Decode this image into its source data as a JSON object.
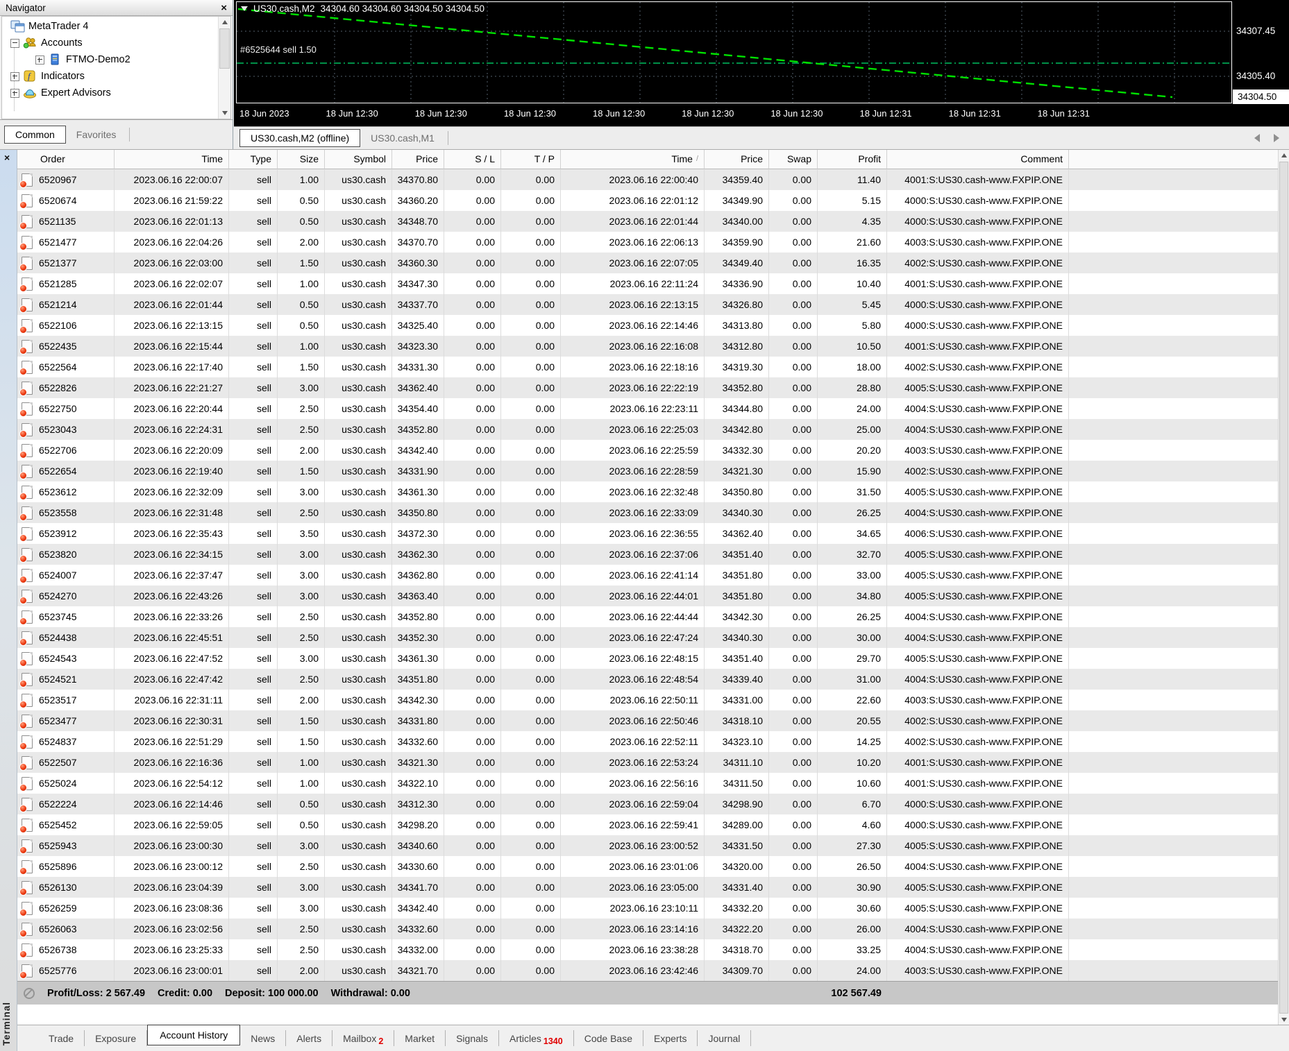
{
  "colors": {
    "chart_line": "#00e100",
    "chart_level": "#00c060",
    "grid": "#55616d",
    "badge": "#e00000"
  },
  "navigator": {
    "title": "Navigator",
    "tree": [
      {
        "label": "MetaTrader 4",
        "icon": "metatrader-icon",
        "level": 0,
        "expander": "none"
      },
      {
        "label": "Accounts",
        "icon": "accounts-icon",
        "level": 1,
        "expander": "minus"
      },
      {
        "label": "FTMO-Demo2",
        "icon": "account-server-icon",
        "level": 2,
        "expander": "plus"
      },
      {
        "label": "Indicators",
        "icon": "indicators-icon",
        "level": 1,
        "expander": "plus"
      },
      {
        "label": "Expert Advisors",
        "icon": "expert-advisors-icon",
        "level": 1,
        "expander": "plus"
      }
    ],
    "tabs": [
      {
        "label": "Common",
        "active": true
      },
      {
        "label": "Favorites",
        "active": false
      }
    ]
  },
  "chart": {
    "symbol_period": "US30.cash,M2",
    "ohlc": "34304.60 34304.60 34304.50 34304.50",
    "order_label": "#6525644 sell 1.50",
    "scale_labels": [
      "34307.45",
      "34305.40"
    ],
    "current_price": "34304.50",
    "time_axis": [
      "18 Jun 2023",
      "18 Jun 12:30",
      "18 Jun 12:30",
      "18 Jun 12:30",
      "18 Jun 12:30",
      "18 Jun 12:30",
      "18 Jun 12:30",
      "18 Jun 12:31",
      "18 Jun 12:31",
      "18 Jun 12:31"
    ]
  },
  "chart_tabs": [
    {
      "label": "US30.cash,M2 (offline)",
      "active": true
    },
    {
      "label": "US30.cash,M1",
      "active": false
    }
  ],
  "terminal": {
    "caption": "Terminal",
    "history": {
      "columns": [
        "Order",
        "Time",
        "Type",
        "Size",
        "Symbol",
        "Price",
        "S / L",
        "T / P",
        "Time",
        "Price",
        "Swap",
        "Profit",
        "Comment"
      ],
      "rows": [
        [
          "6520967",
          "2023.06.16 22:00:07",
          "sell",
          "1.00",
          "us30.cash",
          "34370.80",
          "0.00",
          "0.00",
          "2023.06.16 22:00:40",
          "34359.40",
          "0.00",
          "11.40",
          "4001:S:US30.cash-www.FXPIP.ONE"
        ],
        [
          "6520674",
          "2023.06.16 21:59:22",
          "sell",
          "0.50",
          "us30.cash",
          "34360.20",
          "0.00",
          "0.00",
          "2023.06.16 22:01:12",
          "34349.90",
          "0.00",
          "5.15",
          "4000:S:US30.cash-www.FXPIP.ONE"
        ],
        [
          "6521135",
          "2023.06.16 22:01:13",
          "sell",
          "0.50",
          "us30.cash",
          "34348.70",
          "0.00",
          "0.00",
          "2023.06.16 22:01:44",
          "34340.00",
          "0.00",
          "4.35",
          "4000:S:US30.cash-www.FXPIP.ONE"
        ],
        [
          "6521477",
          "2023.06.16 22:04:26",
          "sell",
          "2.00",
          "us30.cash",
          "34370.70",
          "0.00",
          "0.00",
          "2023.06.16 22:06:13",
          "34359.90",
          "0.00",
          "21.60",
          "4003:S:US30.cash-www.FXPIP.ONE"
        ],
        [
          "6521377",
          "2023.06.16 22:03:00",
          "sell",
          "1.50",
          "us30.cash",
          "34360.30",
          "0.00",
          "0.00",
          "2023.06.16 22:07:05",
          "34349.40",
          "0.00",
          "16.35",
          "4002:S:US30.cash-www.FXPIP.ONE"
        ],
        [
          "6521285",
          "2023.06.16 22:02:07",
          "sell",
          "1.00",
          "us30.cash",
          "34347.30",
          "0.00",
          "0.00",
          "2023.06.16 22:11:24",
          "34336.90",
          "0.00",
          "10.40",
          "4001:S:US30.cash-www.FXPIP.ONE"
        ],
        [
          "6521214",
          "2023.06.16 22:01:44",
          "sell",
          "0.50",
          "us30.cash",
          "34337.70",
          "0.00",
          "0.00",
          "2023.06.16 22:13:15",
          "34326.80",
          "0.00",
          "5.45",
          "4000:S:US30.cash-www.FXPIP.ONE"
        ],
        [
          "6522106",
          "2023.06.16 22:13:15",
          "sell",
          "0.50",
          "us30.cash",
          "34325.40",
          "0.00",
          "0.00",
          "2023.06.16 22:14:46",
          "34313.80",
          "0.00",
          "5.80",
          "4000:S:US30.cash-www.FXPIP.ONE"
        ],
        [
          "6522435",
          "2023.06.16 22:15:44",
          "sell",
          "1.00",
          "us30.cash",
          "34323.30",
          "0.00",
          "0.00",
          "2023.06.16 22:16:08",
          "34312.80",
          "0.00",
          "10.50",
          "4001:S:US30.cash-www.FXPIP.ONE"
        ],
        [
          "6522564",
          "2023.06.16 22:17:40",
          "sell",
          "1.50",
          "us30.cash",
          "34331.30",
          "0.00",
          "0.00",
          "2023.06.16 22:18:16",
          "34319.30",
          "0.00",
          "18.00",
          "4002:S:US30.cash-www.FXPIP.ONE"
        ],
        [
          "6522826",
          "2023.06.16 22:21:27",
          "sell",
          "3.00",
          "us30.cash",
          "34362.40",
          "0.00",
          "0.00",
          "2023.06.16 22:22:19",
          "34352.80",
          "0.00",
          "28.80",
          "4005:S:US30.cash-www.FXPIP.ONE"
        ],
        [
          "6522750",
          "2023.06.16 22:20:44",
          "sell",
          "2.50",
          "us30.cash",
          "34354.40",
          "0.00",
          "0.00",
          "2023.06.16 22:23:11",
          "34344.80",
          "0.00",
          "24.00",
          "4004:S:US30.cash-www.FXPIP.ONE"
        ],
        [
          "6523043",
          "2023.06.16 22:24:31",
          "sell",
          "2.50",
          "us30.cash",
          "34352.80",
          "0.00",
          "0.00",
          "2023.06.16 22:25:03",
          "34342.80",
          "0.00",
          "25.00",
          "4004:S:US30.cash-www.FXPIP.ONE"
        ],
        [
          "6522706",
          "2023.06.16 22:20:09",
          "sell",
          "2.00",
          "us30.cash",
          "34342.40",
          "0.00",
          "0.00",
          "2023.06.16 22:25:59",
          "34332.30",
          "0.00",
          "20.20",
          "4003:S:US30.cash-www.FXPIP.ONE"
        ],
        [
          "6522654",
          "2023.06.16 22:19:40",
          "sell",
          "1.50",
          "us30.cash",
          "34331.90",
          "0.00",
          "0.00",
          "2023.06.16 22:28:59",
          "34321.30",
          "0.00",
          "15.90",
          "4002:S:US30.cash-www.FXPIP.ONE"
        ],
        [
          "6523612",
          "2023.06.16 22:32:09",
          "sell",
          "3.00",
          "us30.cash",
          "34361.30",
          "0.00",
          "0.00",
          "2023.06.16 22:32:48",
          "34350.80",
          "0.00",
          "31.50",
          "4005:S:US30.cash-www.FXPIP.ONE"
        ],
        [
          "6523558",
          "2023.06.16 22:31:48",
          "sell",
          "2.50",
          "us30.cash",
          "34350.80",
          "0.00",
          "0.00",
          "2023.06.16 22:33:09",
          "34340.30",
          "0.00",
          "26.25",
          "4004:S:US30.cash-www.FXPIP.ONE"
        ],
        [
          "6523912",
          "2023.06.16 22:35:43",
          "sell",
          "3.50",
          "us30.cash",
          "34372.30",
          "0.00",
          "0.00",
          "2023.06.16 22:36:55",
          "34362.40",
          "0.00",
          "34.65",
          "4006:S:US30.cash-www.FXPIP.ONE"
        ],
        [
          "6523820",
          "2023.06.16 22:34:15",
          "sell",
          "3.00",
          "us30.cash",
          "34362.30",
          "0.00",
          "0.00",
          "2023.06.16 22:37:06",
          "34351.40",
          "0.00",
          "32.70",
          "4005:S:US30.cash-www.FXPIP.ONE"
        ],
        [
          "6524007",
          "2023.06.16 22:37:47",
          "sell",
          "3.00",
          "us30.cash",
          "34362.80",
          "0.00",
          "0.00",
          "2023.06.16 22:41:14",
          "34351.80",
          "0.00",
          "33.00",
          "4005:S:US30.cash-www.FXPIP.ONE"
        ],
        [
          "6524270",
          "2023.06.16 22:43:26",
          "sell",
          "3.00",
          "us30.cash",
          "34363.40",
          "0.00",
          "0.00",
          "2023.06.16 22:44:01",
          "34351.80",
          "0.00",
          "34.80",
          "4005:S:US30.cash-www.FXPIP.ONE"
        ],
        [
          "6523745",
          "2023.06.16 22:33:26",
          "sell",
          "2.50",
          "us30.cash",
          "34352.80",
          "0.00",
          "0.00",
          "2023.06.16 22:44:44",
          "34342.30",
          "0.00",
          "26.25",
          "4004:S:US30.cash-www.FXPIP.ONE"
        ],
        [
          "6524438",
          "2023.06.16 22:45:51",
          "sell",
          "2.50",
          "us30.cash",
          "34352.30",
          "0.00",
          "0.00",
          "2023.06.16 22:47:24",
          "34340.30",
          "0.00",
          "30.00",
          "4004:S:US30.cash-www.FXPIP.ONE"
        ],
        [
          "6524543",
          "2023.06.16 22:47:52",
          "sell",
          "3.00",
          "us30.cash",
          "34361.30",
          "0.00",
          "0.00",
          "2023.06.16 22:48:15",
          "34351.40",
          "0.00",
          "29.70",
          "4005:S:US30.cash-www.FXPIP.ONE"
        ],
        [
          "6524521",
          "2023.06.16 22:47:42",
          "sell",
          "2.50",
          "us30.cash",
          "34351.80",
          "0.00",
          "0.00",
          "2023.06.16 22:48:54",
          "34339.40",
          "0.00",
          "31.00",
          "4004:S:US30.cash-www.FXPIP.ONE"
        ],
        [
          "6523517",
          "2023.06.16 22:31:11",
          "sell",
          "2.00",
          "us30.cash",
          "34342.30",
          "0.00",
          "0.00",
          "2023.06.16 22:50:11",
          "34331.00",
          "0.00",
          "22.60",
          "4003:S:US30.cash-www.FXPIP.ONE"
        ],
        [
          "6523477",
          "2023.06.16 22:30:31",
          "sell",
          "1.50",
          "us30.cash",
          "34331.80",
          "0.00",
          "0.00",
          "2023.06.16 22:50:46",
          "34318.10",
          "0.00",
          "20.55",
          "4002:S:US30.cash-www.FXPIP.ONE"
        ],
        [
          "6524837",
          "2023.06.16 22:51:29",
          "sell",
          "1.50",
          "us30.cash",
          "34332.60",
          "0.00",
          "0.00",
          "2023.06.16 22:52:11",
          "34323.10",
          "0.00",
          "14.25",
          "4002:S:US30.cash-www.FXPIP.ONE"
        ],
        [
          "6522507",
          "2023.06.16 22:16:36",
          "sell",
          "1.00",
          "us30.cash",
          "34321.30",
          "0.00",
          "0.00",
          "2023.06.16 22:53:24",
          "34311.10",
          "0.00",
          "10.20",
          "4001:S:US30.cash-www.FXPIP.ONE"
        ],
        [
          "6525024",
          "2023.06.16 22:54:12",
          "sell",
          "1.00",
          "us30.cash",
          "34322.10",
          "0.00",
          "0.00",
          "2023.06.16 22:56:16",
          "34311.50",
          "0.00",
          "10.60",
          "4001:S:US30.cash-www.FXPIP.ONE"
        ],
        [
          "6522224",
          "2023.06.16 22:14:46",
          "sell",
          "0.50",
          "us30.cash",
          "34312.30",
          "0.00",
          "0.00",
          "2023.06.16 22:59:04",
          "34298.90",
          "0.00",
          "6.70",
          "4000:S:US30.cash-www.FXPIP.ONE"
        ],
        [
          "6525452",
          "2023.06.16 22:59:05",
          "sell",
          "0.50",
          "us30.cash",
          "34298.20",
          "0.00",
          "0.00",
          "2023.06.16 22:59:41",
          "34289.00",
          "0.00",
          "4.60",
          "4000:S:US30.cash-www.FXPIP.ONE"
        ],
        [
          "6525943",
          "2023.06.16 23:00:30",
          "sell",
          "3.00",
          "us30.cash",
          "34340.60",
          "0.00",
          "0.00",
          "2023.06.16 23:00:52",
          "34331.50",
          "0.00",
          "27.30",
          "4005:S:US30.cash-www.FXPIP.ONE"
        ],
        [
          "6525896",
          "2023.06.16 23:00:12",
          "sell",
          "2.50",
          "us30.cash",
          "34330.60",
          "0.00",
          "0.00",
          "2023.06.16 23:01:06",
          "34320.00",
          "0.00",
          "26.50",
          "4004:S:US30.cash-www.FXPIP.ONE"
        ],
        [
          "6526130",
          "2023.06.16 23:04:39",
          "sell",
          "3.00",
          "us30.cash",
          "34341.70",
          "0.00",
          "0.00",
          "2023.06.16 23:05:00",
          "34331.40",
          "0.00",
          "30.90",
          "4005:S:US30.cash-www.FXPIP.ONE"
        ],
        [
          "6526259",
          "2023.06.16 23:08:36",
          "sell",
          "3.00",
          "us30.cash",
          "34342.40",
          "0.00",
          "0.00",
          "2023.06.16 23:10:11",
          "34332.20",
          "0.00",
          "30.60",
          "4005:S:US30.cash-www.FXPIP.ONE"
        ],
        [
          "6526063",
          "2023.06.16 23:02:56",
          "sell",
          "2.50",
          "us30.cash",
          "34332.60",
          "0.00",
          "0.00",
          "2023.06.16 23:14:16",
          "34322.20",
          "0.00",
          "26.00",
          "4004:S:US30.cash-www.FXPIP.ONE"
        ],
        [
          "6526738",
          "2023.06.16 23:25:33",
          "sell",
          "2.50",
          "us30.cash",
          "34332.00",
          "0.00",
          "0.00",
          "2023.06.16 23:38:28",
          "34318.70",
          "0.00",
          "33.25",
          "4004:S:US30.cash-www.FXPIP.ONE"
        ],
        [
          "6525776",
          "2023.06.16 23:00:01",
          "sell",
          "2.00",
          "us30.cash",
          "34321.70",
          "0.00",
          "0.00",
          "2023.06.16 23:42:46",
          "34309.70",
          "0.00",
          "24.00",
          "4003:S:US30.cash-www.FXPIP.ONE"
        ]
      ]
    },
    "summary": {
      "items": [
        {
          "label": "Profit/Loss:",
          "value": "2 567.49"
        },
        {
          "label": "Credit:",
          "value": "0.00"
        },
        {
          "label": "Deposit:",
          "value": "100 000.00"
        },
        {
          "label": "Withdrawal:",
          "value": "0.00"
        }
      ],
      "balance": "102 567.49"
    },
    "tabs": [
      {
        "label": "Trade"
      },
      {
        "label": "Exposure"
      },
      {
        "label": "Account History",
        "active": true
      },
      {
        "label": "News"
      },
      {
        "label": "Alerts"
      },
      {
        "label": "Mailbox",
        "badge": "2"
      },
      {
        "label": "Market"
      },
      {
        "label": "Signals"
      },
      {
        "label": "Articles",
        "badge": "1340"
      },
      {
        "label": "Code Base"
      },
      {
        "label": "Experts"
      },
      {
        "label": "Journal"
      }
    ]
  }
}
